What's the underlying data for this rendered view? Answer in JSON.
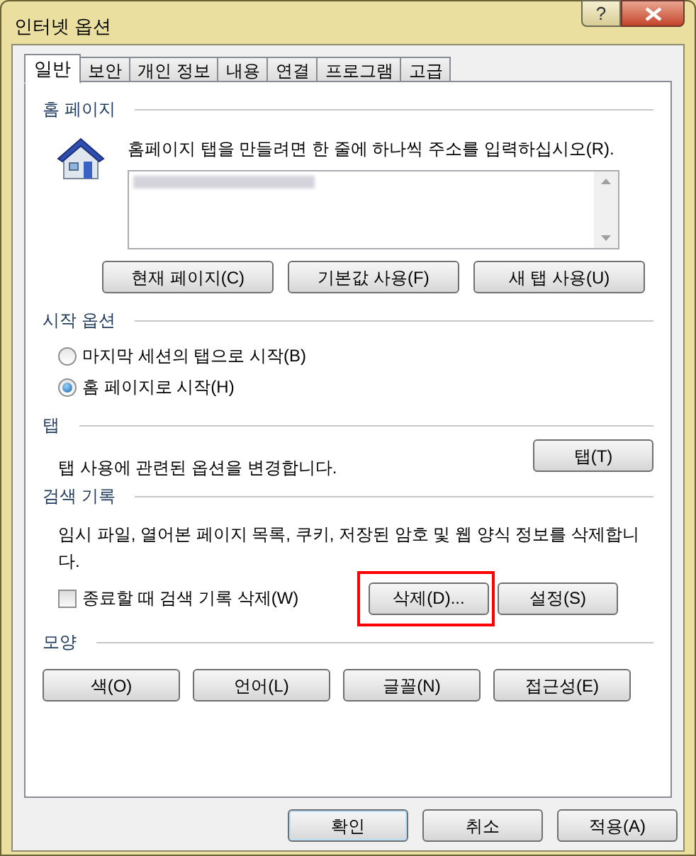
{
  "window": {
    "title": "인터넷 옵션",
    "help_button": "?"
  },
  "tabs": [
    {
      "label": "일반",
      "selected": true
    },
    {
      "label": "보안",
      "selected": false
    },
    {
      "label": "개인 정보",
      "selected": false
    },
    {
      "label": "내용",
      "selected": false
    },
    {
      "label": "연결",
      "selected": false
    },
    {
      "label": "프로그램",
      "selected": false
    },
    {
      "label": "고급",
      "selected": false
    }
  ],
  "home_page": {
    "heading": "홈 페이지",
    "instruction": "홈페이지 탭을 만들려면 한 줄에 하나씩 주소를 입력하십시오(R).",
    "buttons": [
      "현재 페이지(C)",
      "기본값 사용(F)",
      "새 탭 사용(U)"
    ]
  },
  "startup": {
    "heading": "시작 옵션",
    "options": [
      {
        "label": "마지막 세션의 탭으로 시작(B)",
        "selected": false
      },
      {
        "label": "홈 페이지로 시작(H)",
        "selected": true
      }
    ]
  },
  "tabs_section": {
    "heading": "탭",
    "description": "탭 사용에 관련된 옵션을 변경합니다.",
    "button": "탭(T)"
  },
  "browsing_history": {
    "heading": "검색 기록",
    "description": "임시 파일, 열어본 페이지 목록, 쿠키, 저장된 암호 및 웹 양식 정보를 삭제합니다.",
    "checkbox": {
      "label": "종료할 때 검색 기록 삭제(W)",
      "checked": false
    },
    "buttons": [
      {
        "label": "삭제(D)...",
        "highlighted": true
      },
      {
        "label": "설정(S)",
        "highlighted": false
      }
    ]
  },
  "appearance": {
    "heading": "모양",
    "buttons": [
      "색(O)",
      "언어(L)",
      "글꼴(N)",
      "접근성(E)"
    ]
  },
  "footer_buttons": [
    {
      "label": "확인",
      "default": true
    },
    {
      "label": "취소",
      "default": false
    },
    {
      "label": "적용(A)",
      "default": false
    }
  ]
}
